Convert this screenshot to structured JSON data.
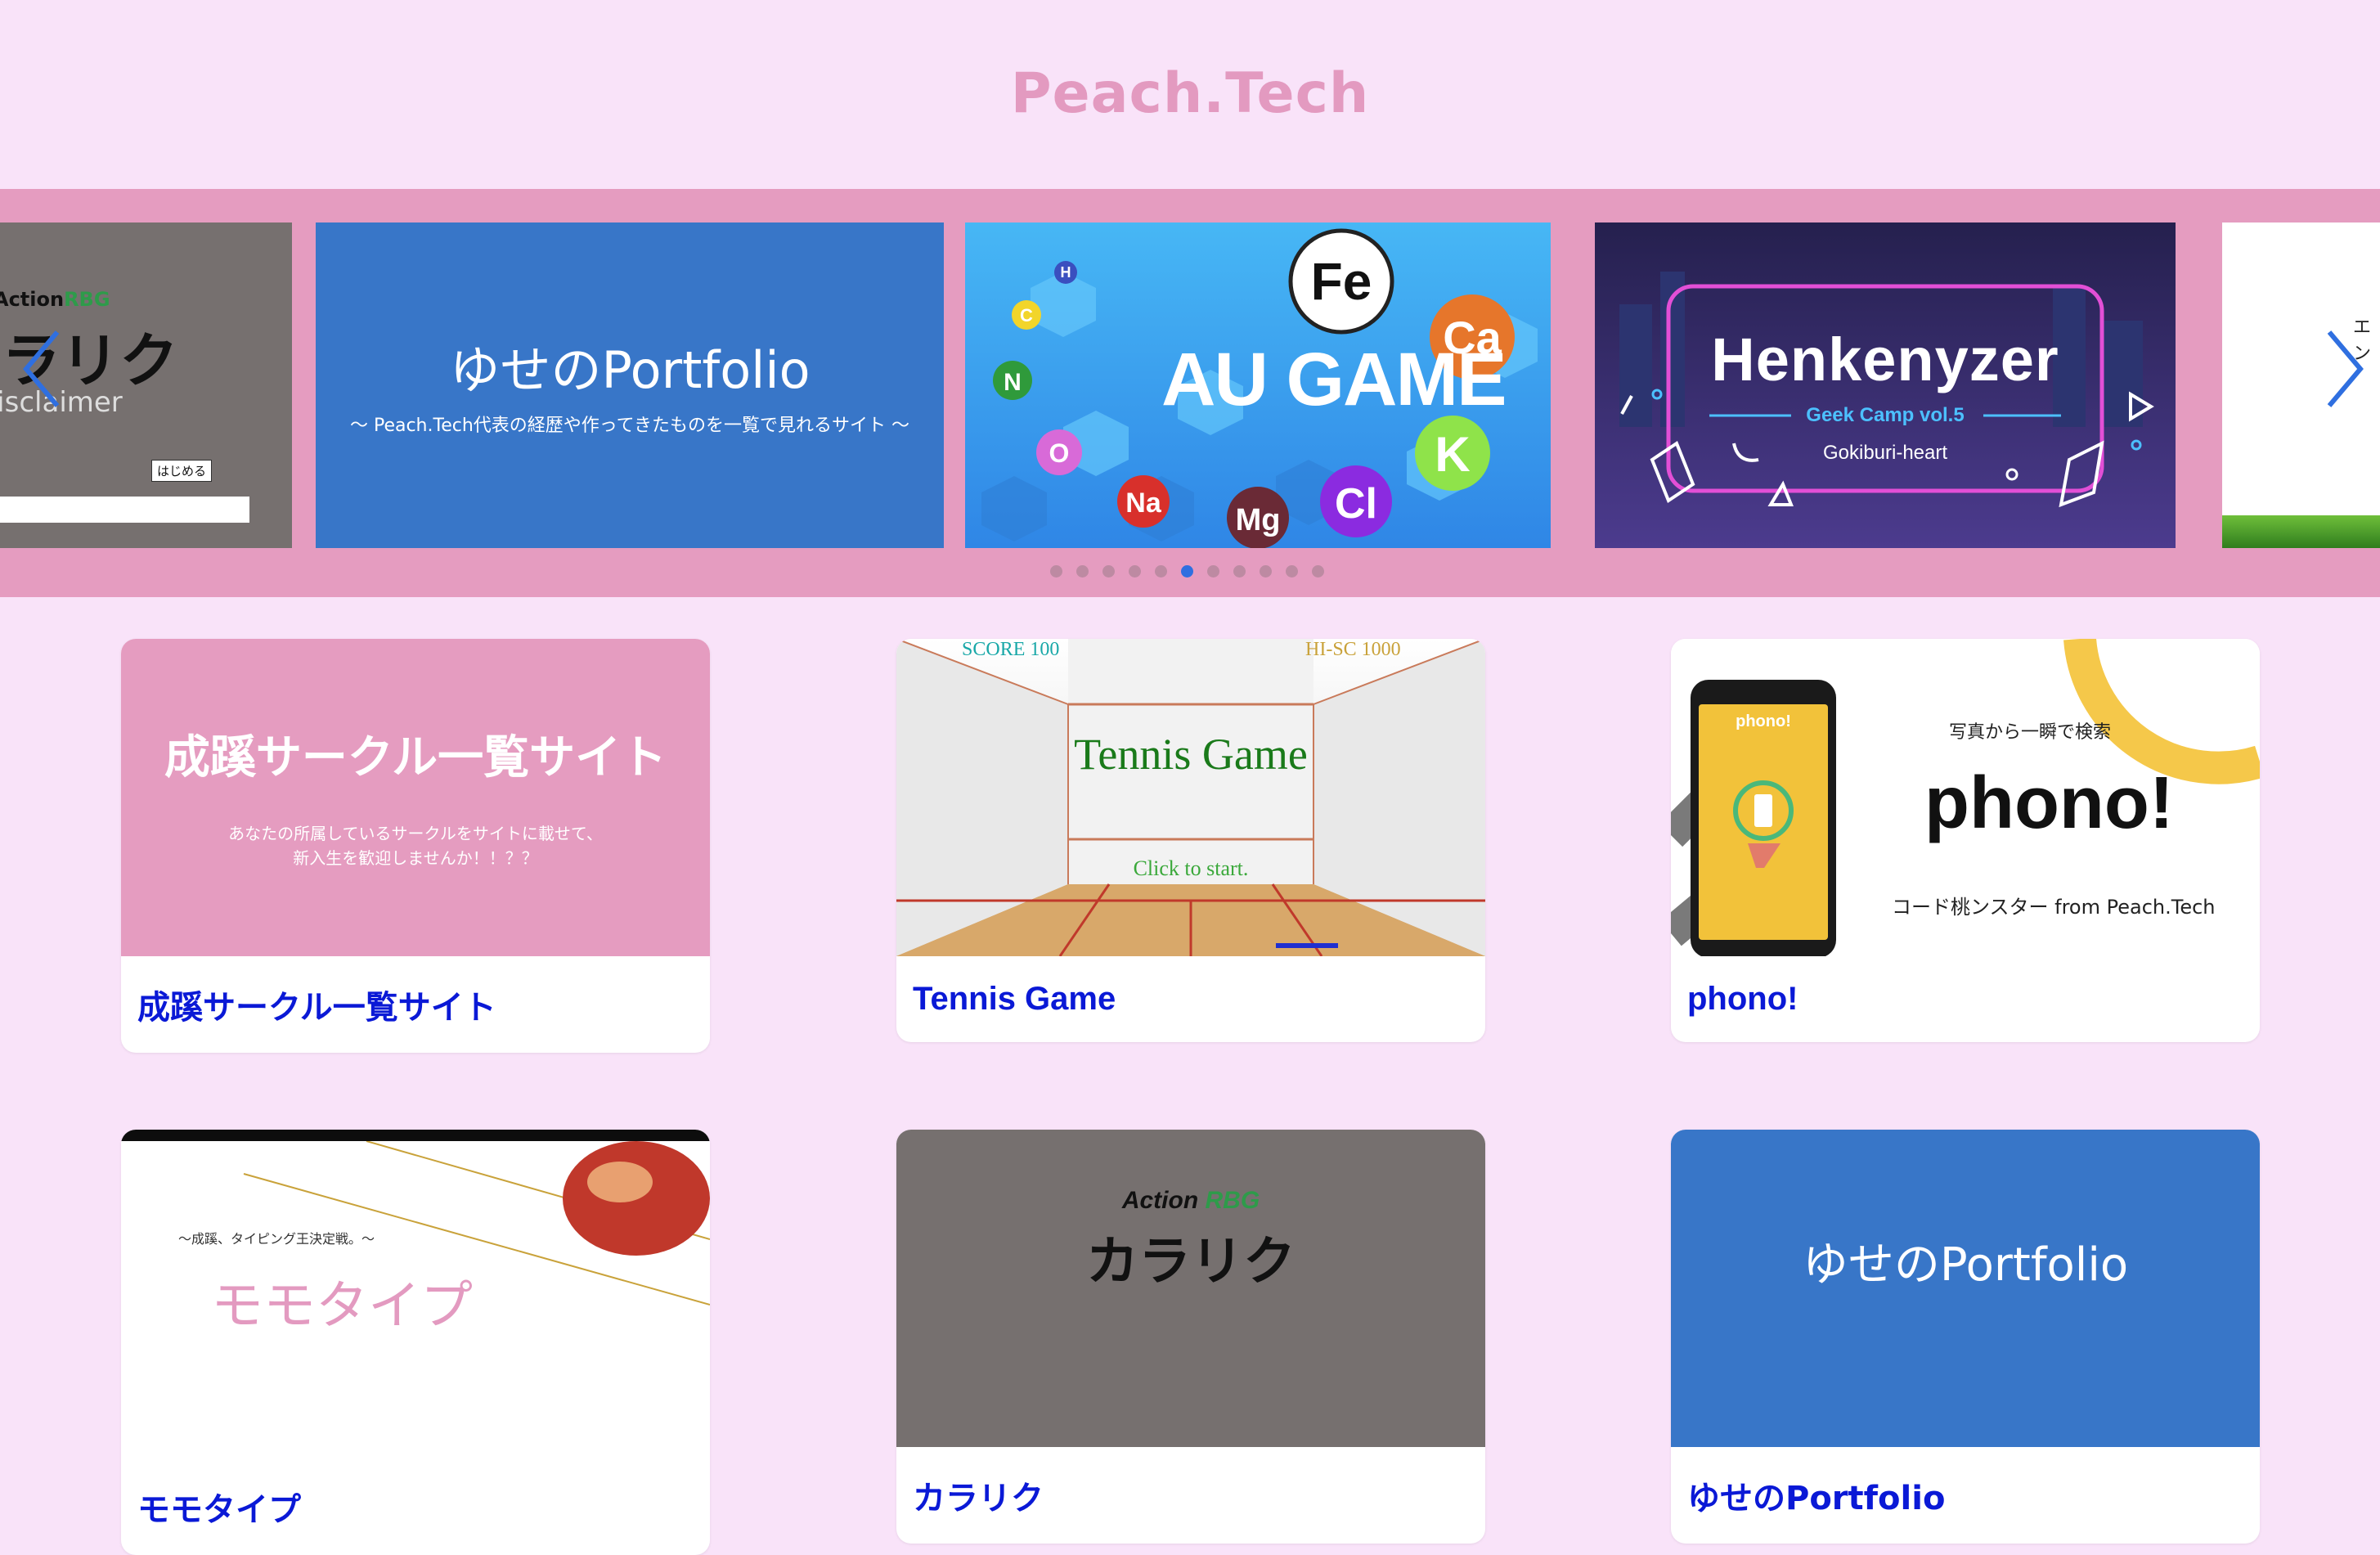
{
  "header": {
    "title": "Peach.Tech"
  },
  "carousel": {
    "slides": [
      {
        "name": "karariku",
        "line1": "Action",
        "line1_accent": "RBG",
        "line2": "カラリク",
        "button": "はじめる",
        "footer": "Disclaimer"
      },
      {
        "name": "portfolio",
        "title": "ゆせのPortfolio",
        "subtitle": "〜 Peach.Tech代表の経歴や作ってきたものを一覧で見れるサイト 〜"
      },
      {
        "name": "au-game",
        "title": "AU GAME",
        "elements": [
          "Fe",
          "Ca",
          "K",
          "Cl",
          "Mg",
          "Na",
          "O",
          "N",
          "C",
          "H"
        ]
      },
      {
        "name": "henkenyzer",
        "title": "Henkenyzer",
        "subtitle": "Geek Camp vol.5",
        "team": "Gokiburi-heart"
      },
      {
        "name": "partial-slide",
        "text": "エン"
      }
    ],
    "dots_count": 11,
    "active_dot": 5,
    "prev_icon": "chevron-left-icon",
    "next_icon": "chevron-right-icon"
  },
  "cards": [
    {
      "title": "成蹊サークル一覧サイト",
      "thumb_title": "成蹊サークル一覧サイト",
      "thumb_text1": "あなたの所属しているサークルをサイトに載せて、",
      "thumb_text2": "新入生を歓迎しませんか！！？？"
    },
    {
      "title": "Tennis Game",
      "score": "SCORE 100",
      "hiscore": "HI-SC 1000",
      "thumb_title": "Tennis Game",
      "thumb_sub": "Click to start."
    },
    {
      "title": "phono!",
      "phone_label": "phono!",
      "thumb_top": "写真から一瞬で検索",
      "thumb_title": "phono!",
      "thumb_sub": "コード桃ンスター from Peach.Tech"
    },
    {
      "title": "モモタイプ",
      "thumb_top": "〜成蹊、タイピング王決定戦。〜",
      "thumb_title": "モモタイプ"
    },
    {
      "title": "カラリク",
      "thumb_line1": "Action",
      "thumb_accent": "RBG",
      "thumb_line2": "カラリク"
    },
    {
      "title": "ゆせのPortfolio",
      "thumb_title": "ゆせのPortfolio"
    }
  ],
  "colors": {
    "page_bg": "#f9e3f9",
    "brand": "#e39ac0",
    "carousel_bg": "#e59cc0",
    "link": "#0a19d6",
    "accent_blue": "#2f6fe0"
  }
}
